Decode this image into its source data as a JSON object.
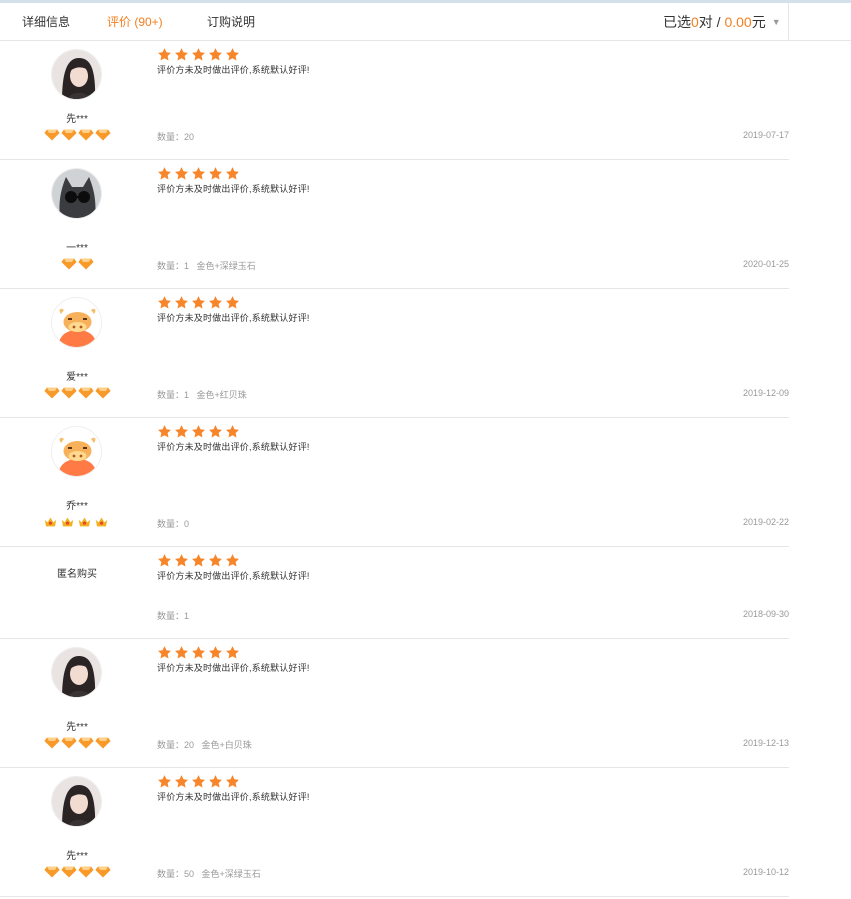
{
  "tabs": [
    {
      "label": "详细信息"
    },
    {
      "label": "评价 (90+)"
    },
    {
      "label": "订购说明"
    }
  ],
  "selection": {
    "prefix": "已选",
    "count": "0",
    "unit": "对",
    "sep": " / ",
    "amount": "0.00",
    "currency": "元"
  },
  "colors": {
    "accent": "#f27f1e",
    "star": "#f7862a",
    "gem": "#f79a2a"
  },
  "reviews": [
    {
      "user": "先***",
      "avatar": "woman-photo",
      "level_icon": "diamond-level",
      "level_count": 4,
      "rating": 5,
      "content": "评价方未及时做出评价,系统默认好评!",
      "meta": "数量：20",
      "date": "2019-07-17"
    },
    {
      "user": "一***",
      "avatar": "cat-photo",
      "level_icon": "diamond-level",
      "level_count": 2,
      "rating": 5,
      "content": "评价方未及时做出评价,系统默认好评!",
      "meta": "数量：1   金色+深绿玉石",
      "date": "2020-01-25"
    },
    {
      "user": "爱***",
      "avatar": "ox-cartoon",
      "level_icon": "diamond-level",
      "level_count": 4,
      "rating": 5,
      "content": "评价方未及时做出评价,系统默认好评!",
      "meta": "数量：1   金色+红贝珠",
      "date": "2019-12-09"
    },
    {
      "user": "乔***",
      "avatar": "ox-cartoon",
      "level_icon": "crown-level",
      "level_count": 4,
      "rating": 5,
      "content": "评价方未及时做出评价,系统默认好评!",
      "meta": "数量：0",
      "date": "2019-02-22"
    },
    {
      "user": "匿名购买",
      "avatar": "",
      "level_icon": "",
      "level_count": 0,
      "rating": 5,
      "content": "评价方未及时做出评价,系统默认好评!",
      "meta": "数量：1",
      "date": "2018-09-30"
    },
    {
      "user": "先***",
      "avatar": "woman-photo",
      "level_icon": "diamond-level",
      "level_count": 4,
      "rating": 5,
      "content": "评价方未及时做出评价,系统默认好评!",
      "meta": "数量：20   金色+白贝珠",
      "date": "2019-12-13"
    },
    {
      "user": "先***",
      "avatar": "woman-photo",
      "level_icon": "diamond-level",
      "level_count": 4,
      "rating": 5,
      "content": "评价方未及时做出评价,系统默认好评!",
      "meta": "数量：50   金色+深绿玉石",
      "date": "2019-10-12"
    }
  ]
}
